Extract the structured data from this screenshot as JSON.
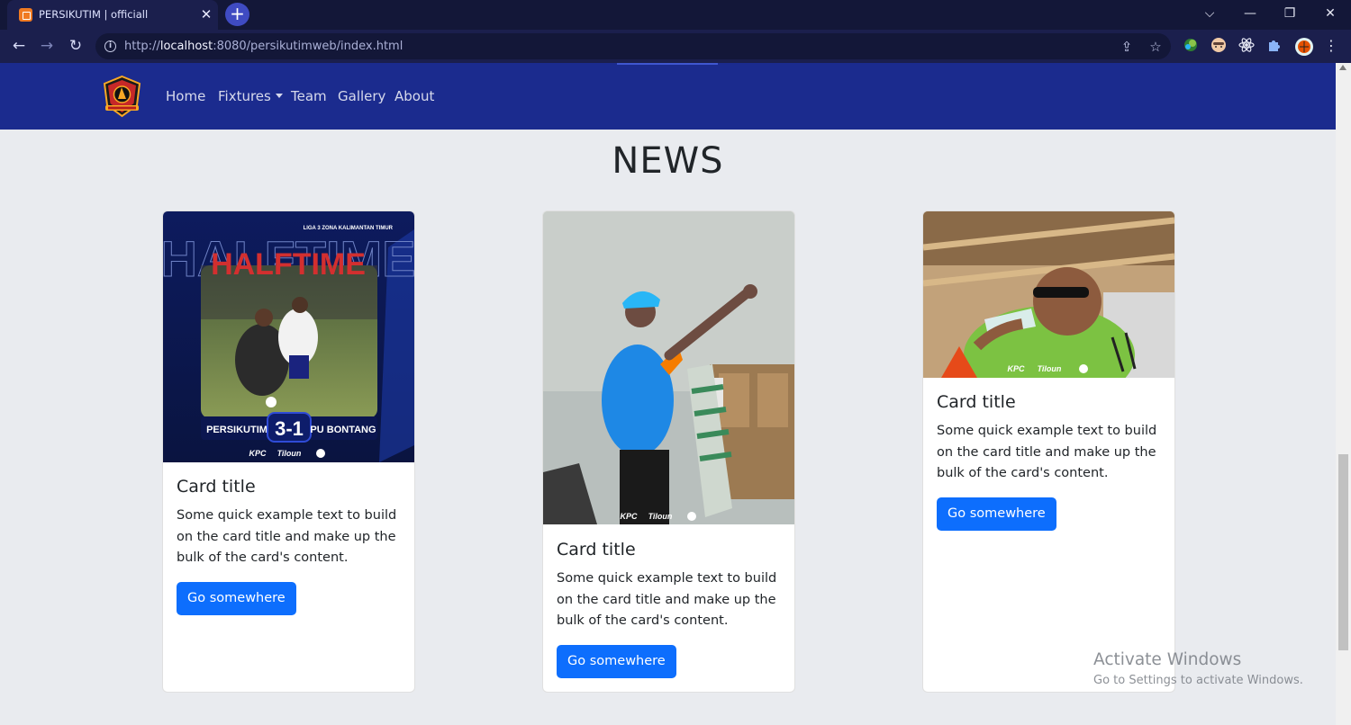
{
  "browser": {
    "tab_title": "PERSIKUTIM | officiall",
    "tab_close": "✕",
    "new_tab": "+",
    "url_prefix": "http://",
    "url_host": "localhost",
    "url_rest": ":8080/persikutimweb/index.html",
    "window_controls": {
      "tab_search": "⌵",
      "minimize": "—",
      "restore": "❐",
      "close": "✕"
    },
    "nav_icons": {
      "back": "←",
      "forward": "→",
      "reload": "↻",
      "info": "i",
      "share": "⇪",
      "bookmark": "☆"
    },
    "extensions": [
      "extension-green-icon",
      "extension-face-icon",
      "extension-react-icon",
      "puzzle-icon",
      "profile-avatar-icon",
      "menu-kebab-icon"
    ]
  },
  "navbar": {
    "brand": "PERSIKUTIM logo",
    "links": [
      {
        "label": "Home"
      },
      {
        "label": "Fixtures"
      },
      {
        "label": "Team"
      },
      {
        "label": "Gallery"
      },
      {
        "label": "About"
      }
    ],
    "bg_color": "#1b2b8e"
  },
  "news": {
    "heading": "NEWS",
    "cards": [
      {
        "title": "Card title",
        "text": "Some quick example text to build on the card title and make up the bulk of the card's content.",
        "button": "Go somewhere",
        "image": {
          "caption_top": "LIGA 3 ZONA KALIMANTAN TIMUR",
          "headline": "HALFTIME",
          "home_team": "PERSIKUTIM",
          "score": "3-1",
          "away_team": "PU BONTANG",
          "sponsors": [
            "KPC",
            "Tiloun"
          ]
        }
      },
      {
        "title": "Card title",
        "text": "Some quick example text to build on the card title and make up the bulk of the card's content.",
        "button": "Go somewhere",
        "image": {
          "sponsors": [
            "KPC",
            "Tiloun"
          ]
        }
      },
      {
        "title": "Card title",
        "text": "Some quick example text to build on the card title and make up the bulk of the card's content.",
        "button": "Go somewhere",
        "image": {
          "sponsors": [
            "KPC",
            "Tiloun"
          ]
        }
      }
    ],
    "button_color": "#0d6efd"
  },
  "watermark": {
    "title": "Activate Windows",
    "subtitle": "Go to Settings to activate Windows."
  }
}
